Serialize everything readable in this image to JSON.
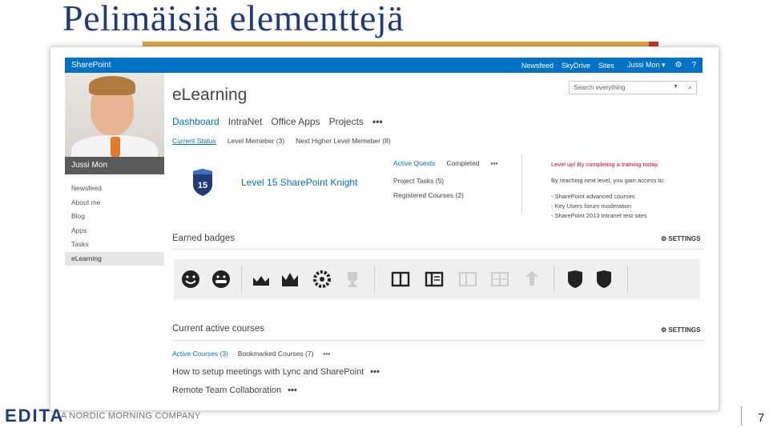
{
  "slide": {
    "title": "Pelimäisiä elementtejä",
    "footer_logo": "EDITA",
    "footer_tag": "A NORDIC MORNING COMPANY",
    "page_number": "7"
  },
  "suitebar": {
    "brand": "SharePoint",
    "links": [
      "Newsfeed",
      "SkyDrive",
      "Sites"
    ],
    "user": "Jussi Mon ▾",
    "gear_icon": "gear-icon",
    "help_icon": "help-icon"
  },
  "profile": {
    "name": "Jussi Mon"
  },
  "leftnav": {
    "items": [
      "Newsfeed",
      "About me",
      "Blog",
      "Apps",
      "Tasks",
      "eLearning"
    ],
    "active_index": 5
  },
  "site": {
    "title": "eLearning",
    "nav": [
      "Dashboard",
      "IntraNet",
      "Office Apps",
      "Projects"
    ],
    "more": "•••"
  },
  "search": {
    "placeholder": "Search everything"
  },
  "status_tabs": [
    "Current Status",
    "Level Memeber (3)",
    "Next Higher Level Memeber (8)"
  ],
  "level": {
    "badge_number": "15",
    "text": "Level 15 SharePoint Knight"
  },
  "quests": {
    "tabs": [
      "Active Quests",
      "Completed"
    ],
    "more": "•••",
    "rows": [
      "Project Tasks (5)",
      "Registered Courses (2)"
    ]
  },
  "levelup": {
    "headline": "Level up! By completing a training today.",
    "intro": "By reaching next level, you gain access to:",
    "items": [
      "- SharePoint advanced courses",
      "- Key Users forum moderation",
      "- SharePoint 2013 Intranet test sites"
    ]
  },
  "badges": {
    "title": "Earned badges",
    "settings": "SETTINGS",
    "items": [
      {
        "icon": "smiley-icon",
        "earned": true
      },
      {
        "icon": "grin-icon",
        "earned": true
      },
      {
        "icon": "crown-small-icon",
        "earned": true
      },
      {
        "icon": "crown-large-icon",
        "earned": true
      },
      {
        "icon": "laurel-icon",
        "earned": true
      },
      {
        "icon": "trophy-icon",
        "earned": false
      },
      {
        "icon": "book-open-icon",
        "earned": true
      },
      {
        "icon": "book-list-icon",
        "earned": true
      },
      {
        "icon": "book-faded-icon",
        "earned": false
      },
      {
        "icon": "book-grid-icon",
        "earned": false
      },
      {
        "icon": "person-icon",
        "earned": false
      },
      {
        "icon": "shield-icon",
        "earned": true
      },
      {
        "icon": "shield-icon",
        "earned": true
      }
    ]
  },
  "courses": {
    "title": "Current active courses",
    "settings": "SETTINGS",
    "tabs": [
      "Active Courses (3)",
      "Bookmarked Courses (7)"
    ],
    "more": "•••",
    "rows": [
      "How to setup meetings with Lync and SharePoint",
      "Remote Team Collaboration"
    ],
    "row_more": "•••"
  },
  "colors": {
    "accent": "#0072c6",
    "title": "#1f3b7a",
    "levelup": "#e4002b",
    "gold_bar": "#d9a441"
  }
}
